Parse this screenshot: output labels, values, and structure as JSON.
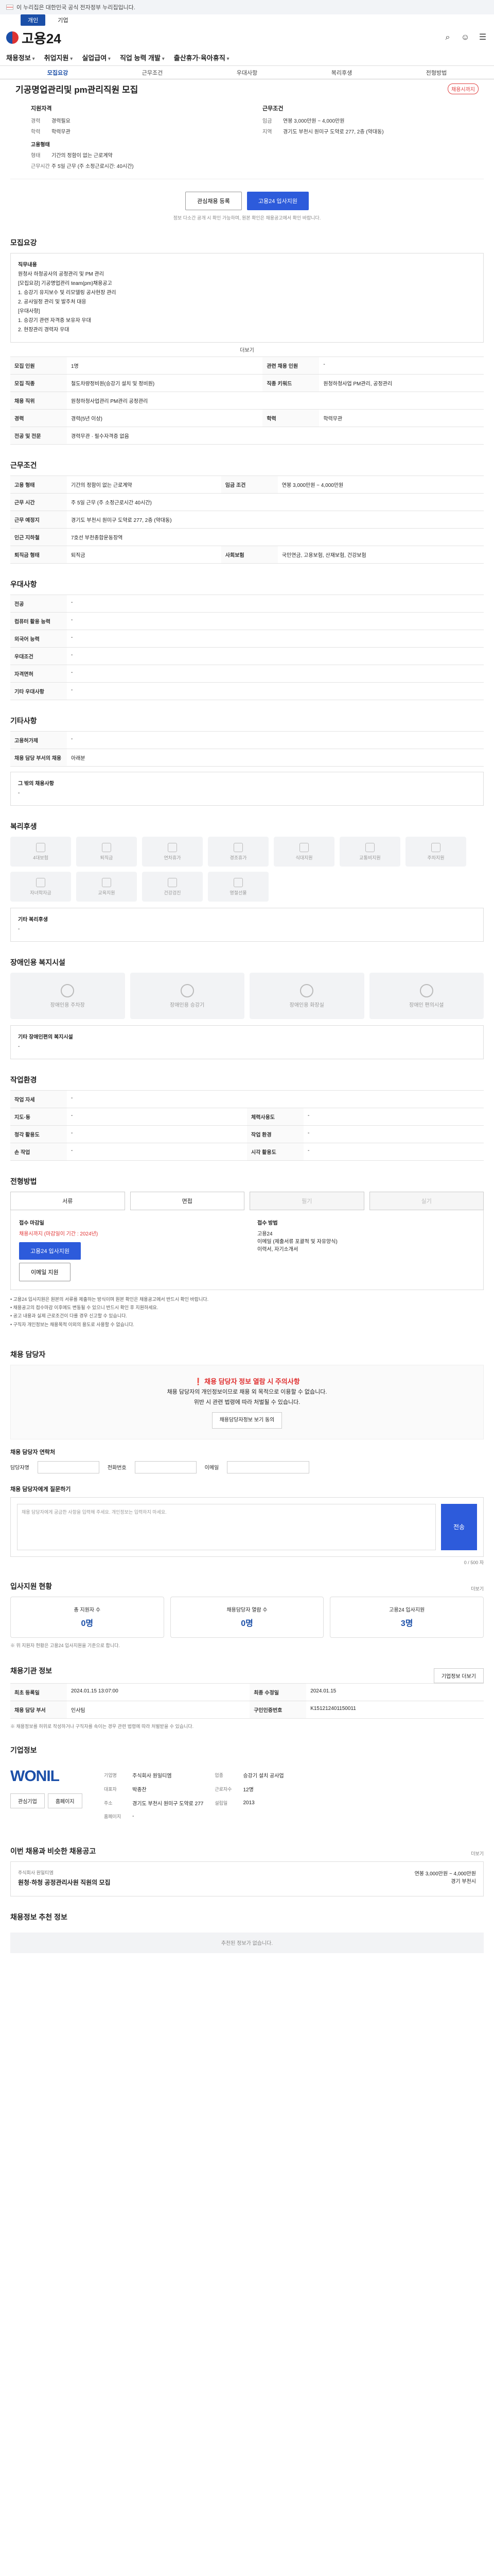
{
  "top_notice": "이 누리집은 대한민국 공식 전자정부 누리집입니다.",
  "utility_tabs": [
    "개인",
    "기업"
  ],
  "logo_text": "고용24",
  "gnb": [
    "채용정보",
    "취업지원",
    "실업급여",
    "직업 능력 개발",
    "출산휴가·육아휴직"
  ],
  "subtabs": [
    "모집요강",
    "근무조건",
    "우대사항",
    "복리후생",
    "전형방법"
  ],
  "job": {
    "title": "기공명업관리및 pm관리직원 모집",
    "badge": "채용시까지",
    "company_heading": "지원자격",
    "career_label": "경력",
    "career_value": "경력필요",
    "edu_label": "학력",
    "edu_value": "학력무관",
    "work_heading": "근무조건",
    "wage_label": "임금",
    "wage_value": "연봉 3,000만원 ~ 4,000만원",
    "region_label": "지역",
    "region_value": "경기도 부천시 원미구 도약로 277, 2층 (약대동)",
    "form_heading": "고용형태",
    "form_label": "형태",
    "form_value": "기간의 정함이 없는 근로계약",
    "hours_label": "근무시간",
    "hours_value": "주 5일 근무 (주 소정근로시간: 40시간)"
  },
  "actions": {
    "interest": "관심채용 등록",
    "apply": "고용24 입사지원"
  },
  "notice_line": "정보 다소간 공개 시 확인 가능하며, 원본 확인은 채용공고에서 확인 바랍니다.",
  "recruit": {
    "heading": "모집요강",
    "duty_title": "직무내용",
    "duty_lines": [
      "원청사 하청공사의 공정관리 및 PM 관리",
      "[모집요강] 기공명업관리 team(pm)채용공고",
      "1. 승강기 유지보수 및 리모델링 공사현장 관리",
      "2. 공사일정 관리 및 발주처 대응",
      "[우대사항]",
      "1. 승강기 관련 자격증 보유자 우대",
      "2. 현장관리 경력자 우대"
    ],
    "more": "더보기",
    "rows": [
      {
        "k": "모집 인원",
        "v": "1명",
        "k2": "관련 채용 인원",
        "v2": "-"
      },
      {
        "k": "모집 직종",
        "v": "철도차량정비원(승강기 설치 및 정비원)",
        "k2": "직종 키워드",
        "v2": "원청하청사업 PM관리, 공정관리"
      },
      {
        "k": "채용 직위",
        "v": "원청하청사업관리 PM관리 공정관리",
        "k2": "",
        "v2": ""
      },
      {
        "k": "경력",
        "v": "경력(5년 이상)",
        "k2": "학력",
        "v2": "학력무관"
      },
      {
        "k": "전공 및 전문",
        "v": "경력무관 · 필수자격증 없음",
        "k2": "",
        "v2": ""
      }
    ]
  },
  "conditions": {
    "heading": "근무조건",
    "rows": [
      {
        "k": "고용 형태",
        "v": "기간의 정함이 없는 근로계약",
        "k2": "임금 조건",
        "v2": "연봉 3,000만원 ~ 4,000만원"
      },
      {
        "k": "근무 시간",
        "v": "주 5일 근무 (주 소정근로시간 40시간)",
        "k2": "",
        "v2": ""
      },
      {
        "k": "근무 예정지",
        "v": "경기도 부천시 원미구 도약로 277, 2층 (약대동)",
        "k2": "",
        "v2": ""
      },
      {
        "k": "인근 지하철",
        "v": "7호선 부천종합운동장역",
        "k2": "",
        "v2": ""
      },
      {
        "k": "퇴직금 형태",
        "v": "퇴직금",
        "k2": "사회보험",
        "v2": "국민연금, 고용보험, 산재보험, 건강보험"
      }
    ]
  },
  "preferred": {
    "heading": "우대사항",
    "rows": [
      {
        "k": "전공",
        "v": "-"
      },
      {
        "k": "컴퓨터 활용 능력",
        "v": "-"
      },
      {
        "k": "외국어 능력",
        "v": "-"
      },
      {
        "k": "우대조건",
        "v": "-"
      },
      {
        "k": "자격면허",
        "v": "-"
      },
      {
        "k": "기타 우대사항",
        "v": "-"
      }
    ]
  },
  "other": {
    "heading": "기타사항",
    "rows": [
      {
        "k": "고용허가제",
        "v": "-"
      },
      {
        "k": "채용 담당 부서의 채용",
        "v": "아래분"
      }
    ],
    "extra_label": "그 밖의 채용사항",
    "extra_value": "-"
  },
  "welfare": {
    "heading": "복리후생",
    "items": [
      "4대보험",
      "퇴직금",
      "연차휴가",
      "경조휴가",
      "식대지원",
      "교통비지원",
      "주차지원",
      "자녀학자금",
      "교육지원",
      "건강검진",
      "명절선물"
    ],
    "other_label": "기타 복리후생",
    "other_value": "-"
  },
  "disability": {
    "heading": "장애인용 복지시설",
    "items": [
      "장애인용 주차장",
      "장애인용 승강기",
      "장애인용 화장실",
      "장애인 편의시설"
    ],
    "note_label": "기타 장애인편의 복지시설",
    "note_value": "-"
  },
  "workplace": {
    "heading": "작업환경",
    "rows": [
      {
        "k": "작업 자세",
        "v": "-",
        "k2": "",
        "v2": ""
      },
      {
        "k": "지도·동",
        "v": "-",
        "k2": "체력사용도",
        "v2": "-"
      },
      {
        "k": "청각 활용도",
        "v": "-",
        "k2": "작업 환경",
        "v2": "-"
      },
      {
        "k": "손 작업",
        "v": "-",
        "k2": "시각 활용도",
        "v2": "-"
      }
    ]
  },
  "selection": {
    "heading": "전형방법",
    "choices": [
      "서류",
      "면접",
      "필기",
      "실기"
    ],
    "apply_title": "접수 마감일",
    "apply_value": "채용시까지 (마감일이 기간 : 2024년)",
    "apply_button": "고용24 입사지원",
    "apply_button2": "이메일 지원",
    "doc_title": "접수 방법",
    "doc_lines": [
      "고용24",
      "이메일 (제출서류 포괄적 및 자유양식)",
      "이력서, 자기소개서"
    ],
    "bullets": [
      "• 고용24 입사지원은 원본의 서류를 제출하는 방식이며 원본 확인은 채용공고에서 반드시 확인 바랍니다.",
      "• 채용공고의 접수마감 이후에도 변동될 수 있으니 반드시 확인 후 지원하세요.",
      "• 공고 내용과 실제 근로조건이 다를 경우 신고할 수 있습니다.",
      "• 구직자 개인정보는 채용목적 이외의 용도로 사용할 수 없습니다."
    ]
  },
  "manager": {
    "heading": "채용 담당자",
    "warn_title": "채용 담당자 정보 열람 시 주의사항",
    "warn_lines": [
      "채용 담당자의 개인정보이므로 채용 외 목적으로 이용할 수 없습니다.",
      "위반 시 관련 법령에 따라 처벌될 수 있습니다."
    ],
    "warn_button": "채용담당자정보 보기 동의",
    "contact_label": "채용 담당자 연락처",
    "name_label": "담당자명",
    "phone_label": "전화번호",
    "email_label": "이메일",
    "inquiry_label": "채용 담당자에게 질문하기",
    "inquiry_placeholder": "채용 담당자에게 궁금한 사항을 입력해 주세요. 개인정보는 입력하지 마세요.",
    "send": "전송",
    "inquiry_count": "0 / 500 자"
  },
  "stats": {
    "heading": "입사지원 현황",
    "more": "더보기",
    "items": [
      {
        "label": "총 지원자 수",
        "value": "0명"
      },
      {
        "label": "채용담당자 열람 수",
        "value": "0명"
      },
      {
        "label": "고용24 입사지원",
        "value": "3명"
      }
    ],
    "note": "※ 위 지원자 현황은 고용24 입사지원을 기준으로 합니다."
  },
  "info": {
    "heading": "채용기관 정보",
    "button": "기업정보 더보기",
    "rows": [
      {
        "k": "최초 등록일",
        "v": "2024.01.15 13:07:00",
        "k2": "최종 수정일",
        "v2": "2024.01.15"
      },
      {
        "k": "채용 담당 부서",
        "v": "인사팀",
        "k2": "구인인증번호",
        "v2": "K151212401150011"
      }
    ],
    "note": "※ 채용정보를 허위로 작성하거나 구직자를 속이는 경우 관련 법령에 따라 처벌받을 수 있습니다."
  },
  "company": {
    "heading": "기업정보",
    "logo": "WONIL",
    "rows": [
      {
        "k": "기업명",
        "v": "주식회사 원일티엠",
        "k2": "업종",
        "v2": "승강기 설치 공사업"
      },
      {
        "k": "대표자",
        "v": "박종찬",
        "k2": "근로자수",
        "v2": "12명"
      },
      {
        "k": "주소",
        "v": "경기도 부천시 원미구 도약로 277",
        "k2": "설립일",
        "v2": "2013"
      },
      {
        "k": "홈페이지",
        "v": "-",
        "k2": "",
        "v2": ""
      }
    ],
    "buttons": [
      "관심기업",
      "홈페이지"
    ]
  },
  "similar": {
    "heading": "이번 채용과 비슷한 채용공고",
    "more": "더보기",
    "company": "주식회사 원일티엠",
    "title": "원청·하청 공정관리사원 직원의 모집",
    "wage": "연봉 3,000만원 ~ 4,000만원",
    "region": "경기 부천시"
  },
  "recent": {
    "heading": "채용정보 추천 정보",
    "empty": "추천된 정보가 없습니다."
  }
}
